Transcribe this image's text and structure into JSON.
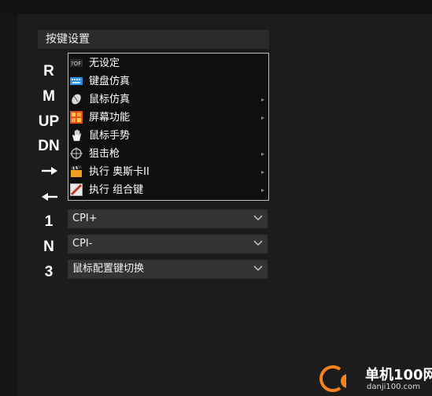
{
  "section": {
    "title": "按键设置"
  },
  "keys": {
    "r": "R",
    "m": "M",
    "up": "UP",
    "dn": "DN",
    "k1": "1",
    "kn": "N",
    "k3": "3"
  },
  "menu": {
    "items": [
      {
        "label": "无设定",
        "icon": "no-setting-icon",
        "submenu": false
      },
      {
        "label": "键盘仿真",
        "icon": "keyboard-icon",
        "submenu": false
      },
      {
        "label": "鼠标仿真",
        "icon": "mouse-icon",
        "submenu": true
      },
      {
        "label": "屏幕功能",
        "icon": "screen-function-icon",
        "submenu": true
      },
      {
        "label": "鼠标手势",
        "icon": "hand-gesture-icon",
        "submenu": false
      },
      {
        "label": "狙击枪",
        "icon": "crosshair-icon",
        "submenu": true
      },
      {
        "label": "执行 奥斯卡II",
        "icon": "clapperboard-icon",
        "submenu": true
      },
      {
        "label": "执行 组合键",
        "icon": "combo-key-icon",
        "submenu": true
      }
    ],
    "submenu_glyph": "▸"
  },
  "selects": [
    {
      "value": "CPI+"
    },
    {
      "value": "CPI-"
    },
    {
      "value": "鼠标配置键切换"
    }
  ],
  "watermark": {
    "main": "单机100网",
    "sub": "danji100.com"
  },
  "colors": {
    "background": "#191919",
    "header": "#2b2b2b",
    "select": "#333333",
    "menu_border": "#bdbdbd",
    "accent": "#f5821f"
  }
}
